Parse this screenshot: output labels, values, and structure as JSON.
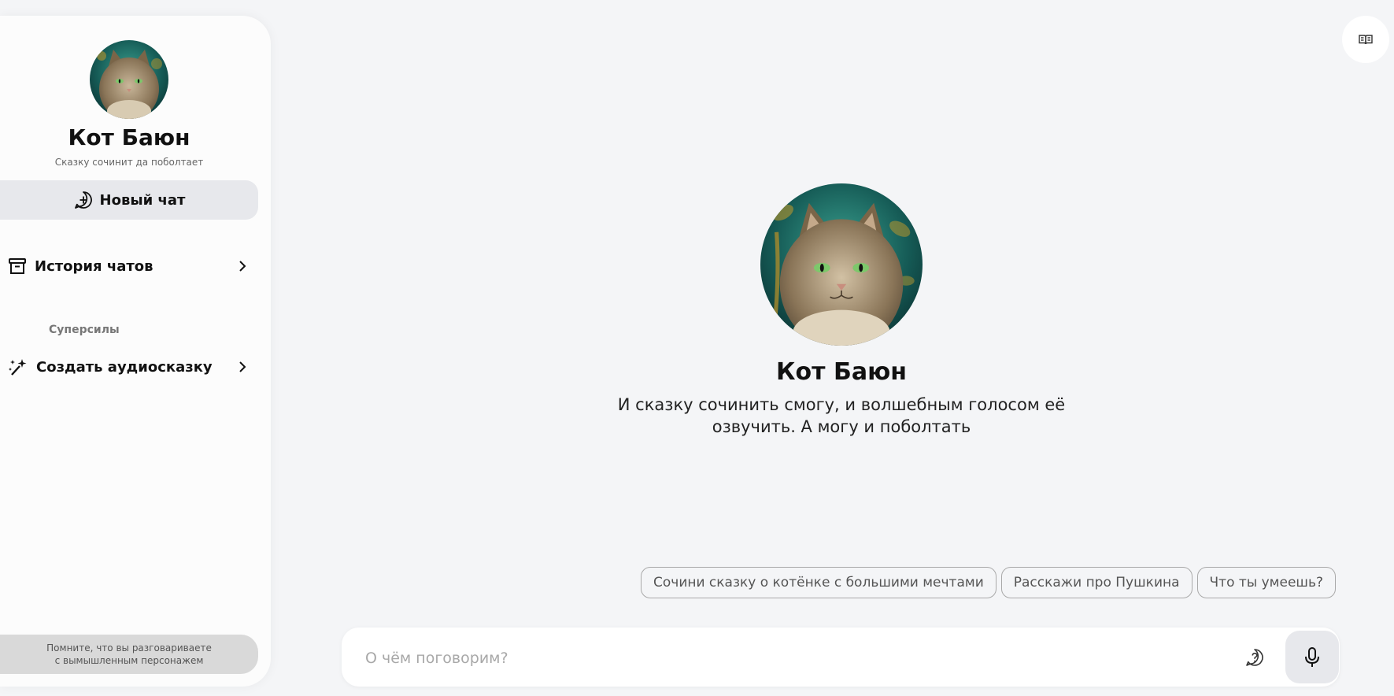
{
  "character": {
    "name": "Кот Баюн",
    "tagline": "Сказку сочинит да поболтает",
    "intro": "И сказку сочинить смогу, и волшебным голосом её озвучить. А могу и поболтать"
  },
  "sidebar": {
    "new_chat_label": "Новый чат",
    "history_label": "История чатов",
    "section_label": "Суперсилы",
    "superpowers": [
      {
        "label": "Создать аудиосказку"
      }
    ],
    "disclaimer": "Помните, что вы разговариваете с вымышленным персонажем"
  },
  "suggestions": [
    "Сочини сказку о котёнке с большими мечтами",
    "Расскажи про Пушкина",
    "Что ты умеешь?"
  ],
  "composer": {
    "placeholder": "О чём поговорим?",
    "value": ""
  },
  "icons": {
    "top_right": "book-icon",
    "new_chat": "chat-plus-icon",
    "history": "archive-icon",
    "superpower": "magic-wand-icon",
    "help": "question-icon",
    "mic": "microphone-icon"
  },
  "colors": {
    "background": "#f4f5f7",
    "sidebar": "#fcfcfc",
    "button_bg": "#e7e8ec",
    "disclaimer_bg": "#d9d9d9"
  }
}
